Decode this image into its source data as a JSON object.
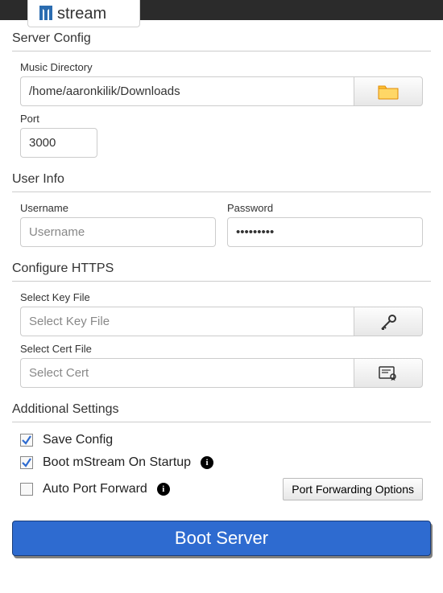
{
  "app_name": "stream",
  "sections": {
    "server_config": "Server Config",
    "user_info": "User Info",
    "configure_https": "Configure HTTPS",
    "additional_settings": "Additional Settings"
  },
  "fields": {
    "music_dir_label": "Music Directory",
    "music_dir_value": "/home/aaronkilik/Downloads",
    "port_label": "Port",
    "port_value": "3000",
    "username_label": "Username",
    "username_placeholder": "Username",
    "username_value": "",
    "password_label": "Password",
    "password_value": "•••••••••",
    "key_file_label": "Select Key File",
    "key_file_placeholder": "Select Key File",
    "key_file_value": "",
    "cert_file_label": "Select Cert File",
    "cert_file_placeholder": "Select Cert",
    "cert_file_value": ""
  },
  "checkboxes": {
    "save_config_label": "Save Config",
    "save_config_checked": true,
    "boot_startup_label": "Boot mStream On Startup",
    "boot_startup_checked": true,
    "auto_port_fwd_label": "Auto Port Forward",
    "auto_port_fwd_checked": false
  },
  "buttons": {
    "port_fwd_options": "Port Forwarding Options",
    "boot_server": "Boot Server"
  },
  "colors": {
    "primary": "#2e6bd0",
    "logo": "#2b6cb0"
  }
}
